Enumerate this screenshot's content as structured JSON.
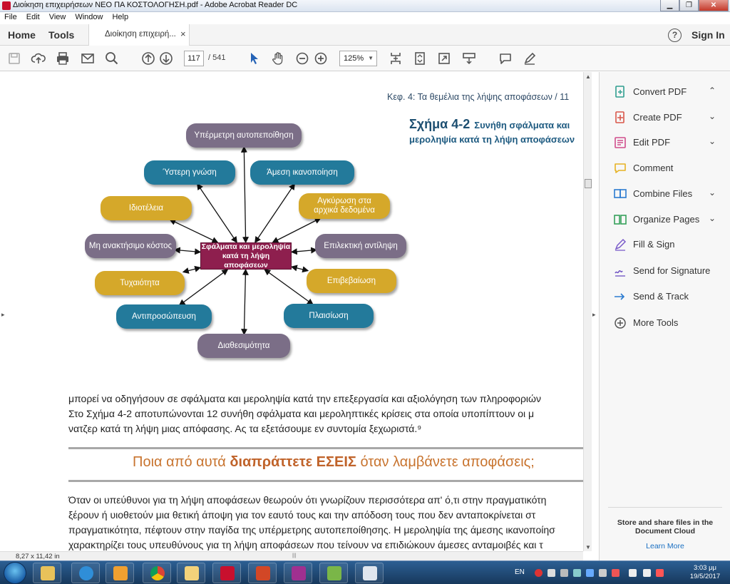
{
  "window": {
    "title": "Διοίκηση επιχειρήσεων ΝΕΟ ΠΑ ΚΟΣΤΟΛΟΓΗΣΗ.pdf - Adobe Acrobat Reader DC",
    "minimize_glyph": "▁",
    "maximize_glyph": "❐",
    "close_glyph": "✕"
  },
  "menu": [
    "File",
    "Edit",
    "View",
    "Window",
    "Help"
  ],
  "tabs": {
    "home": "Home",
    "tools": "Tools",
    "document": "Διοίκηση επιχειρή...",
    "close_glyph": "×",
    "help_glyph": "?",
    "sign_in": "Sign In"
  },
  "toolbar": {
    "current_page": "117",
    "total_pages": "/ 541",
    "zoom": "125%",
    "zoom_arrow": "▼"
  },
  "document": {
    "page_header": "Κεφ. 4: Τα θεμέλια της λήψης αποφάσεων  /  11",
    "figure_number": "Σχήμα 4-2",
    "figure_title_line1": "Συνήθη σφάλματα και",
    "figure_title_line2": "μεροληψία κατά τη λήψη αποφάσεων",
    "center_box_line1": "Σφάλματα και μεροληψία",
    "center_box_line2": "κατά τη λήψη αποφάσεων",
    "bubbles": [
      {
        "label": "Υπέρμετρη αυτοπεποίθηση",
        "color": "grey"
      },
      {
        "label": "Άμεση ικανοποίηση",
        "color": "blue"
      },
      {
        "label": "Αγκύρωση στα αρχικά δεδομένα",
        "color": "gold"
      },
      {
        "label": "Επιλεκτική αντίληψη",
        "color": "grey"
      },
      {
        "label": "Επιβεβαίωση",
        "color": "gold"
      },
      {
        "label": "Πλαισίωση",
        "color": "blue"
      },
      {
        "label": "Διαθεσιμότητα",
        "color": "grey"
      },
      {
        "label": "Αντιπροσώπευση",
        "color": "blue"
      },
      {
        "label": "Τυχαιότητα",
        "color": "gold"
      },
      {
        "label": "Μη ανακτήσιμο κόστος",
        "color": "grey"
      },
      {
        "label": "Ιδιοτέλεια",
        "color": "gold"
      },
      {
        "label": "Ύστερη γνώση",
        "color": "blue"
      }
    ],
    "paragraph1": [
      "μπορεί να οδηγήσουν σε σφάλματα και μεροληψία κατά την επεξεργασία και αξιολόγηση των πληροφοριών",
      "Στο Σχήμα 4-2 αποτυπώνονται 12 συνήθη σφάλματα και μεροληπτικές κρίσεις στα οποία υποπίπτουν οι μ",
      "νατζερ κατά τη λήψη μιας απόφασης. Ας τα εξετάσουμε εν συντομία ξεχωριστά.⁹"
    ],
    "question_before": "Ποια από αυτά ",
    "question_bold": "διαπράττετε ΕΣΕΙΣ",
    "question_after": " όταν λαμβάνετε αποφάσεις;",
    "paragraph2": [
      "Όταν οι υπεύθυνοι για τη λήψη αποφάσεων θεωρούν ότι γνωρίζουν περισσότερα απ' ό,τι στην πραγματικότη",
      "ξέρουν ή υιοθετούν μια θετική άποψη για τον εαυτό τους και την απόδοση τους που δεν ανταποκρίνεται στ",
      "πραγματικότητα, πέφτουν στην παγίδα της υπέρμετρης αυτοπεποίθησης. Η μεροληψία της άμεσης ικανοποίησ",
      "χαρακτηρίζει τους υπευθύνους για τη λήψη αποφάσεων που τείνουν να επιδιώκουν άμεσες ανταμοιβές και τ"
    ],
    "page_size": "8,27 x 11,42 in",
    "left_arrow": "▸",
    "collapse_arrow": "▸",
    "scroll_up": "▲",
    "scroll_down": "▼",
    "hscroll_grip": "|||"
  },
  "tools_panel": {
    "items": [
      {
        "label": "Convert PDF",
        "chevron": "⌃",
        "color": "#2f9e8f",
        "icon": "convert-pdf-icon"
      },
      {
        "label": "Create PDF",
        "chevron": "⌄",
        "color": "#d9574a",
        "icon": "create-pdf-icon"
      },
      {
        "label": "Edit PDF",
        "chevron": "⌄",
        "color": "#d14d8c",
        "icon": "edit-pdf-icon"
      },
      {
        "label": "Comment",
        "chevron": "",
        "color": "#e6b224",
        "icon": "comment-icon"
      },
      {
        "label": "Combine Files",
        "chevron": "⌄",
        "color": "#2b7bd0",
        "icon": "combine-files-icon"
      },
      {
        "label": "Organize Pages",
        "chevron": "⌄",
        "color": "#36a05b",
        "icon": "organize-pages-icon"
      },
      {
        "label": "Fill & Sign",
        "chevron": "",
        "color": "#7a5bc9",
        "icon": "fill-sign-icon"
      },
      {
        "label": "Send for Signature",
        "chevron": "",
        "color": "#6c4fc2",
        "icon": "send-signature-icon"
      },
      {
        "label": "Send & Track",
        "chevron": "",
        "color": "#2b7bd0",
        "icon": "send-track-icon"
      },
      {
        "label": "More Tools",
        "chevron": "",
        "color": "#555555",
        "icon": "more-tools-icon"
      }
    ],
    "cloud_text_line1": "Store and share files in the",
    "cloud_text_line2": "Document Cloud",
    "learn_more": "Learn More"
  },
  "taskbar": {
    "language": "EN",
    "time": "3:03 μμ",
    "date": "19/5/2017"
  }
}
